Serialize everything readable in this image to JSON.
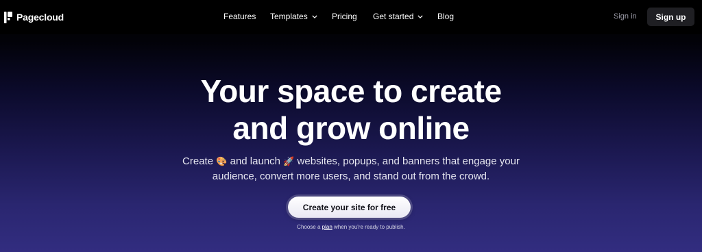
{
  "brand": {
    "name": "Pagecloud",
    "logo_icon": "pagecloud-logo-icon"
  },
  "nav": {
    "items": [
      {
        "label": "Features",
        "has_dropdown": false
      },
      {
        "label": "Templates",
        "has_dropdown": true
      },
      {
        "label": "Pricing",
        "has_dropdown": false
      },
      {
        "label": "Get started",
        "has_dropdown": true
      },
      {
        "label": "Blog",
        "has_dropdown": false
      }
    ],
    "sign_in": "Sign in",
    "sign_up": "Sign up"
  },
  "hero": {
    "title_line1": "Your space to create",
    "title_line2": "and grow online",
    "subtitle_part1": "Create",
    "emoji_palette": "🎨",
    "subtitle_part2": "and launch",
    "emoji_rocket": "🚀",
    "subtitle_part3": "websites, popups, and banners that engage your",
    "subtitle_line2": "audience, convert more users, and stand out from the crowd.",
    "cta": "Create your site for free",
    "note_before": "Choose a",
    "note_link": "plan",
    "note_after": "when you're ready to publish."
  },
  "colors": {
    "background_top": "#000000",
    "background_bottom": "#322d80",
    "signup_bg": "#1f1f23",
    "cta_bg": "#ffffff",
    "signin_text": "#9a9aa6"
  }
}
